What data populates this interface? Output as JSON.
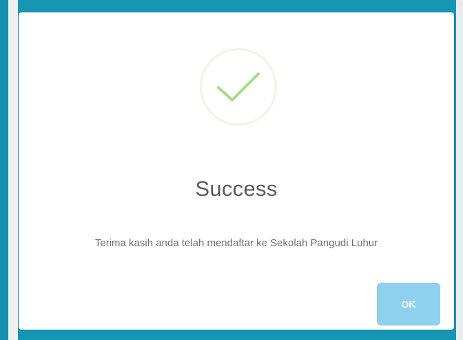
{
  "dialog": {
    "title": "Success",
    "message": "Terima kasih anda telah mendaftar ke Sekolah Pangudi Luhur",
    "ok_label": "OK",
    "icon": "checkmark-icon"
  },
  "colors": {
    "backdrop": "#1597b3",
    "check": "#a5dc86",
    "icon_ring": "#edf6e5",
    "ok_button": "#8fd0ef",
    "title_text": "#595959"
  }
}
